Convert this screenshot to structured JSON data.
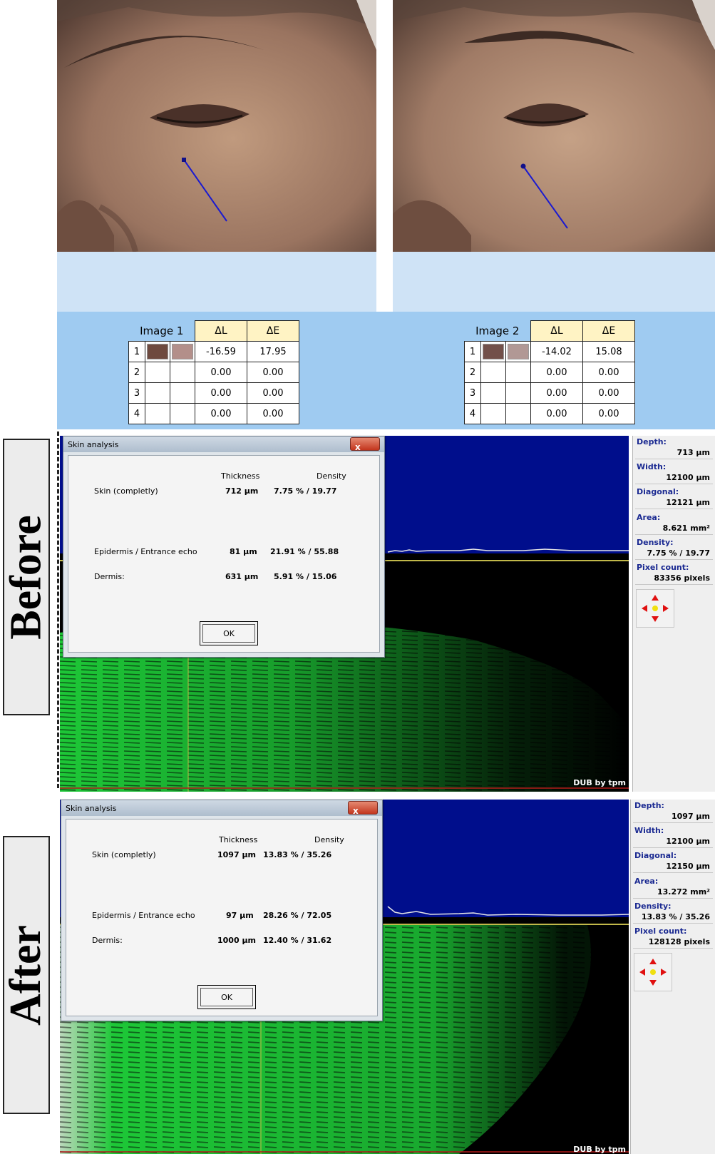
{
  "photos": {
    "image1": {
      "title": "Image 1",
      "headers": [
        "ΔL",
        "ΔE"
      ],
      "rows": [
        {
          "idx": "1",
          "swatch1": "#6e4a3f",
          "swatch2": "#b38f8a",
          "dl": "-16.59",
          "de": "17.95"
        },
        {
          "idx": "2",
          "dl": "0.00",
          "de": "0.00"
        },
        {
          "idx": "3",
          "dl": "0.00",
          "de": "0.00"
        },
        {
          "idx": "4",
          "dl": "0.00",
          "de": "0.00"
        }
      ]
    },
    "image2": {
      "title": "Image 2",
      "headers": [
        "ΔL",
        "ΔE"
      ],
      "rows": [
        {
          "idx": "1",
          "swatch1": "#72504a",
          "swatch2": "#b19895",
          "dl": "-14.02",
          "de": "15.08"
        },
        {
          "idx": "2",
          "dl": "0.00",
          "de": "0.00"
        },
        {
          "idx": "3",
          "dl": "0.00",
          "de": "0.00"
        },
        {
          "idx": "4",
          "dl": "0.00",
          "de": "0.00"
        }
      ]
    }
  },
  "labels": {
    "before": "Before",
    "after": "After"
  },
  "before": {
    "dialog": {
      "title": "Skin analysis",
      "close": "x",
      "col_thickness": "Thickness",
      "col_density": "Density",
      "rows": [
        {
          "name": "Skin (completly)",
          "thickness": "712 µm",
          "density": "7.75 %  /  19.77"
        },
        {
          "name": "Epidermis / Entrance echo",
          "thickness": "81 µm",
          "density": "21.91 %  /  55.88"
        },
        {
          "name": "Dermis:",
          "thickness": "631 µm",
          "density": "5.91 %  /  15.06"
        }
      ],
      "ok": "OK"
    },
    "info": {
      "depth_label": "Depth:",
      "depth": "713 µm",
      "width_label": "Width:",
      "width": "12100 µm",
      "diagonal_label": "Diagonal:",
      "diagonal": "12121 µm",
      "area_label": "Area:",
      "area": "8.621 mm²",
      "density_label": "Density:",
      "density": "7.75 %  /  19.77",
      "pixel_label": "Pixel count:",
      "pixel": "83356 pixels"
    },
    "watermark": "DUB by tpm"
  },
  "after": {
    "dialog": {
      "title": "Skin analysis",
      "close": "x",
      "col_thickness": "Thickness",
      "col_density": "Density",
      "rows": [
        {
          "name": "Skin (completly)",
          "thickness": "1097 µm",
          "density": "13.83 %  /  35.26"
        },
        {
          "name": "Epidermis / Entrance echo",
          "thickness": "97 µm",
          "density": "28.26 %  /  72.05"
        },
        {
          "name": "Dermis:",
          "thickness": "1000 µm",
          "density": "12.40 %  /  31.62"
        }
      ],
      "ok": "OK"
    },
    "info": {
      "depth_label": "Depth:",
      "depth": "1097 µm",
      "width_label": "Width:",
      "width": "12100 µm",
      "diagonal_label": "Diagonal:",
      "diagonal": "12150 µm",
      "area_label": "Area:",
      "area": "13.272 mm²",
      "density_label": "Density:",
      "density": "13.83 %  /  35.26",
      "pixel_label": "Pixel count:",
      "pixel": "128128 pixels"
    },
    "watermark": "DUB by tpm"
  },
  "colors": {
    "blue_panel": "#000e8c",
    "echo_green": "#1fd23a",
    "line_blue": "#1a1ad0"
  }
}
